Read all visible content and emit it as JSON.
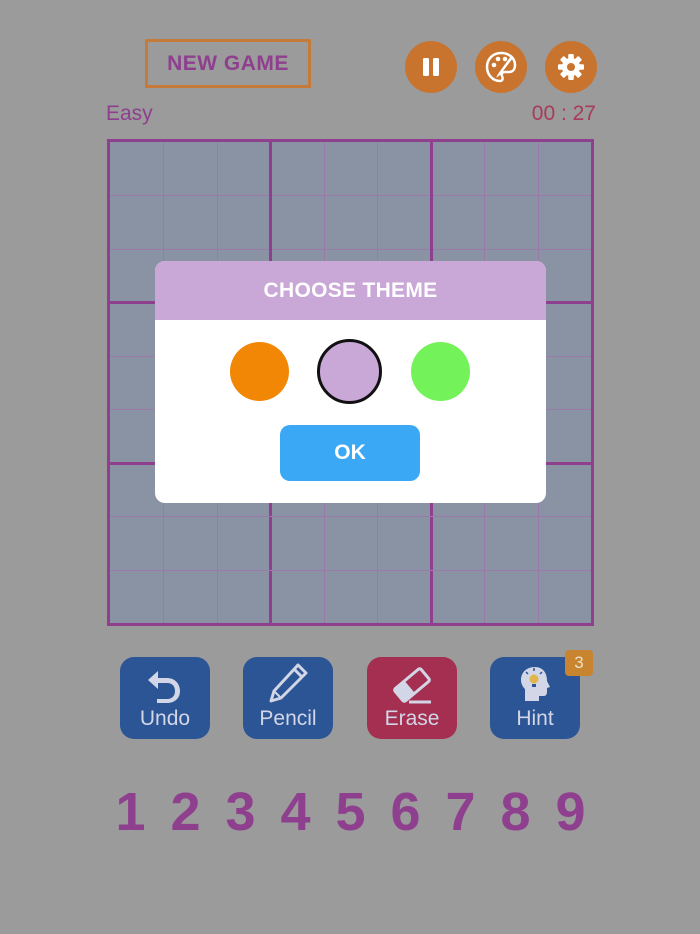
{
  "header": {
    "new_game_label": "NEW GAME",
    "difficulty": "Easy",
    "timer": "00 : 27"
  },
  "top_buttons": [
    {
      "name": "pause-button",
      "icon": "pause-icon"
    },
    {
      "name": "theme-button",
      "icon": "palette-icon"
    },
    {
      "name": "settings-button",
      "icon": "gear-icon"
    }
  ],
  "dialog": {
    "title": "CHOOSE THEME",
    "ok_label": "OK",
    "themes": [
      {
        "name": "orange",
        "color": "#f28705",
        "selected": false
      },
      {
        "name": "purple",
        "color": "#c9a7d6",
        "selected": true
      },
      {
        "name": "green",
        "color": "#74f25a",
        "selected": false
      }
    ]
  },
  "tools": [
    {
      "label": "Undo",
      "icon": "undo-icon",
      "color": "#2c5595"
    },
    {
      "label": "Pencil",
      "icon": "pencil-icon",
      "color": "#2c5595"
    },
    {
      "label": "Erase",
      "icon": "eraser-icon",
      "color": "#a42f50"
    },
    {
      "label": "Hint",
      "icon": "hint-head-icon",
      "color": "#2c5595",
      "badge": "3"
    }
  ],
  "numpad": [
    "1",
    "2",
    "3",
    "4",
    "5",
    "6",
    "7",
    "8",
    "9"
  ],
  "colors": {
    "background": "#9b9b9b",
    "accent_orange": "#c8732e",
    "grid_purple": "#8e3f8e",
    "board_fill": "#8a93a4",
    "ok_blue": "#3aa8f5"
  }
}
